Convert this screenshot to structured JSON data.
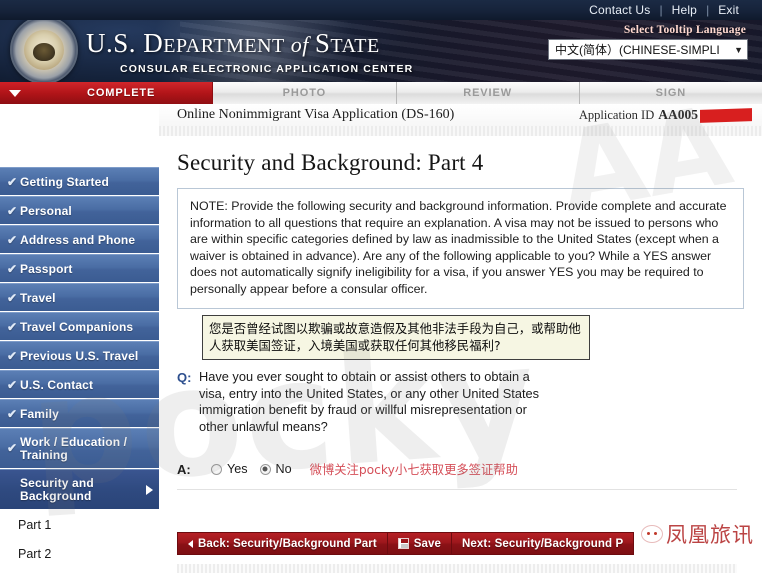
{
  "topbar": {
    "links": [
      "Contact Us",
      "Help",
      "Exit"
    ],
    "separator": "|"
  },
  "banner": {
    "title_us": "U.S. ",
    "title_department": "D",
    "title_department_rest": "EPARTMENT",
    "title_of": " of ",
    "title_state_cap": "S",
    "title_state_rest": "TATE",
    "subtitle": "CONSULAR ELECTRONIC APPLICATION CENTER",
    "seal_name": "us-department-of-state-seal"
  },
  "language": {
    "label": "Select Tooltip Language",
    "selected": "中文(简体）(CHINESE-SIMPLI",
    "arrow": "▼"
  },
  "steps": [
    {
      "label": "COMPLETE",
      "active": true
    },
    {
      "label": "PHOTO",
      "active": false
    },
    {
      "label": "REVIEW",
      "active": false
    },
    {
      "label": "SIGN",
      "active": false
    }
  ],
  "sidebar": {
    "items": [
      {
        "label": "Getting Started",
        "complete": true
      },
      {
        "label": "Personal",
        "complete": true
      },
      {
        "label": "Address and Phone",
        "complete": true
      },
      {
        "label": "Passport",
        "complete": true
      },
      {
        "label": "Travel",
        "complete": true
      },
      {
        "label": "Travel Companions",
        "complete": true
      },
      {
        "label": "Previous U.S. Travel",
        "complete": true
      },
      {
        "label": "U.S. Contact",
        "complete": true
      },
      {
        "label": "Family",
        "complete": true
      },
      {
        "label": "Work / Education / Training",
        "complete": true
      },
      {
        "label": "Security and Background",
        "complete": false,
        "current": true
      }
    ],
    "sub_items": [
      "Part 1",
      "Part 2"
    ],
    "check_glyph": "✔"
  },
  "application": {
    "form_title": "Online Nonimmigrant Visa Application (DS-160)",
    "app_id_label": "Application ID",
    "app_id_value": "AA005"
  },
  "page": {
    "title": "Security and Background: Part 4",
    "note": "NOTE: Provide the following security and background information. Provide complete and accurate information to all questions that require an explanation. A visa may not be issued to persons who are within specific categories defined by law as inadmissible to the United States (except when a waiver is obtained in advance). Are any of the following applicable to you? While a YES answer does not automatically signify ineligibility for a visa, if you answer YES you may be required to personally appear before a consular officer."
  },
  "question": {
    "tooltip": "您是否曾经试图以欺骗或故意造假及其他非法手段为自己，或帮助他人获取美国签证，入境美国或获取任何其他移民福利?",
    "q_label": "Q:",
    "q_text": "Have you ever sought to obtain or assist others to obtain a visa, entry into the United States, or any other United States immigration benefit by fraud or willful misrepresentation or other unlawful means?",
    "a_label": "A:",
    "option_yes": "Yes",
    "option_no": "No",
    "selected": "No",
    "promo_text": "微博关注pocky小七获取更多签证帮助"
  },
  "buttons": {
    "back": "Back: Security/Background Part",
    "save": "Save",
    "next": "Next: Security/Background P"
  },
  "watermarks": {
    "big": "pocky",
    "mid": "AA",
    "logo_text": "凤凰旅讯"
  },
  "colors": {
    "accent_red": "#b52025",
    "nav_blue": "#4a6da4",
    "nav_current": "#2f4a80",
    "tooltip_bg": "#f6f6e3",
    "promo_red": "#d2414b"
  }
}
